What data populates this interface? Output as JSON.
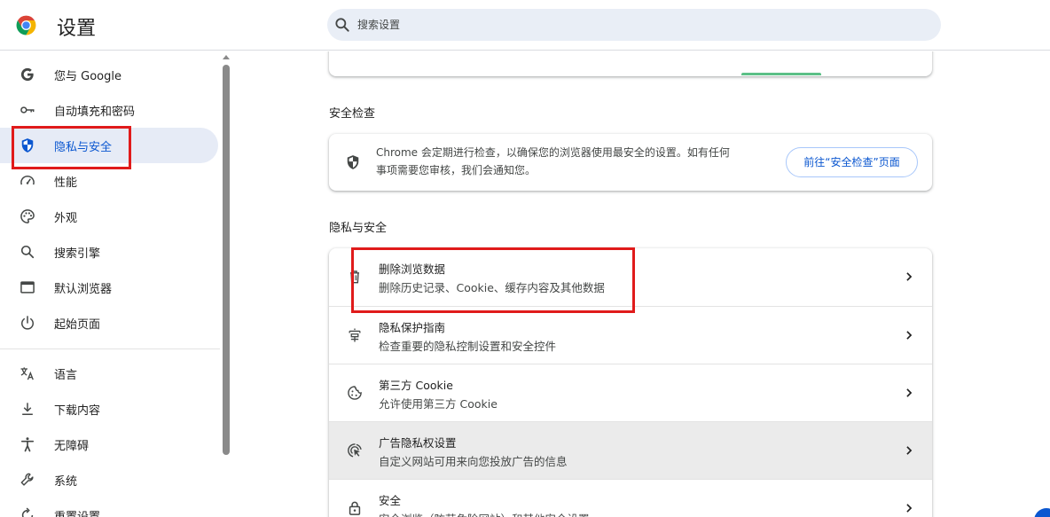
{
  "header": {
    "title": "设置",
    "search_placeholder": "搜索设置"
  },
  "sidebar": {
    "items": [
      {
        "label": "您与 Google",
        "icon": "google-g-icon"
      },
      {
        "label": "自动填充和密码",
        "icon": "key-icon"
      },
      {
        "label": "隐私与安全",
        "icon": "shield-icon",
        "active": true
      },
      {
        "label": "性能",
        "icon": "speedometer-icon"
      },
      {
        "label": "外观",
        "icon": "palette-icon"
      },
      {
        "label": "搜索引擎",
        "icon": "search-icon"
      },
      {
        "label": "默认浏览器",
        "icon": "browser-window-icon"
      },
      {
        "label": "起始页面",
        "icon": "power-icon"
      },
      {
        "label": "语言",
        "icon": "translate-icon"
      },
      {
        "label": "下载内容",
        "icon": "download-icon"
      },
      {
        "label": "无障碍",
        "icon": "accessibility-icon"
      },
      {
        "label": "系统",
        "icon": "wrench-icon"
      },
      {
        "label": "重置设置",
        "icon": "reset-icon"
      }
    ]
  },
  "main": {
    "safety_check": {
      "section_title": "安全检查",
      "description_line1": "Chrome 会定期进行检查，以确保您的浏览器使用最安全的设置。如有任何",
      "description_line2": "事项需要您审核，我们会通知您。",
      "button_label": "前往“安全检查”页面"
    },
    "privacy": {
      "section_title": "隐私与安全",
      "rows": [
        {
          "title": "删除浏览数据",
          "subtitle": "删除历史记录、Cookie、缓存内容及其他数据",
          "icon": "trash-icon"
        },
        {
          "title": "隐私保护指南",
          "subtitle": "检查重要的隐私控制设置和安全控件",
          "icon": "privacy-guide-icon"
        },
        {
          "title": "第三方 Cookie",
          "subtitle": "允许使用第三方 Cookie",
          "icon": "cookie-icon"
        },
        {
          "title": "广告隐私权设置",
          "subtitle": "自定义网站可用来向您投放广告的信息",
          "icon": "ad-privacy-icon"
        },
        {
          "title": "安全",
          "subtitle": "安全浏览（防范危险网站）和其他安全设置",
          "icon": "lock-icon"
        }
      ]
    }
  },
  "colors": {
    "accent": "#0b57d0",
    "active_nav_bg": "#e6ebf6",
    "annotation_red": "#e01b1b"
  }
}
